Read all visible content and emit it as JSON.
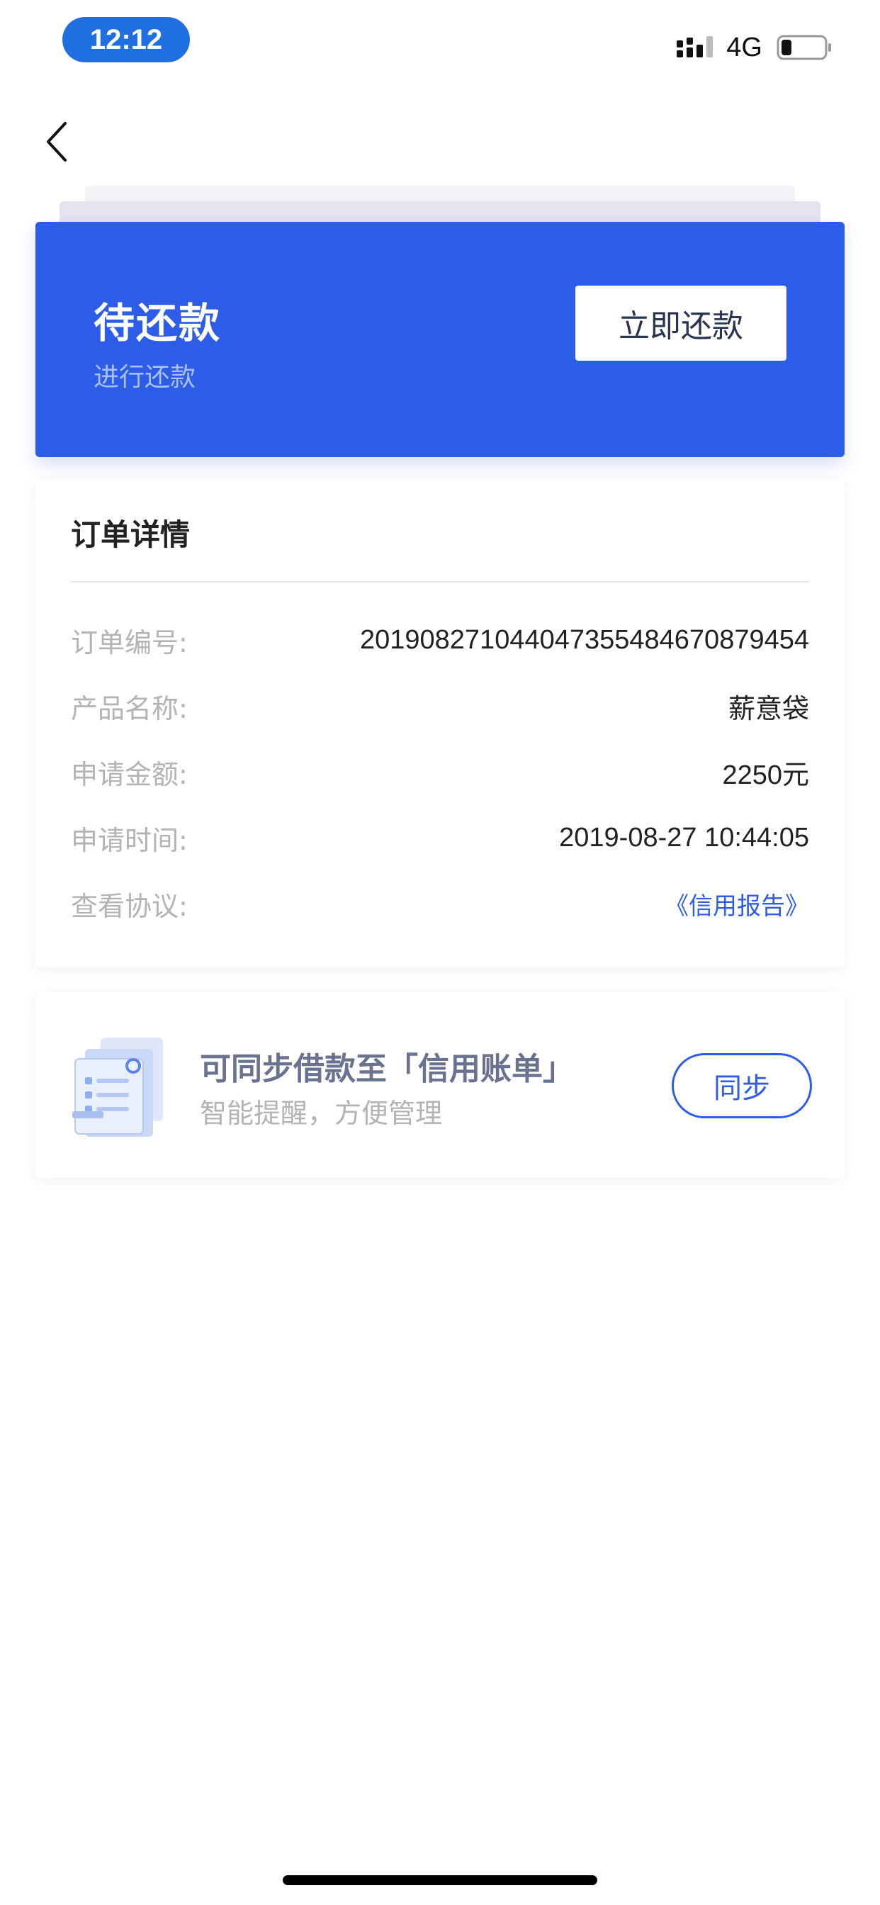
{
  "status_bar": {
    "time": "12:12",
    "network": "4G"
  },
  "header": {
    "back_icon": "chevron-left-icon"
  },
  "status_card": {
    "title": "待还款",
    "subtitle": "进行还款",
    "action_label": "立即还款",
    "background_color": "#2d5ce6"
  },
  "order_details": {
    "title": "订单详情",
    "rows": [
      {
        "label": "订单编号:",
        "value": "20190827104404735548467087945 4"
      },
      {
        "label": "产品名称:",
        "value": "薪意袋"
      },
      {
        "label": "申请金额:",
        "value": "2250元"
      },
      {
        "label": "申请时间:",
        "value": "2019-08-27 10:44:05"
      }
    ],
    "agreement": {
      "label": "查看协议:",
      "link_text": "《信用报告》"
    }
  },
  "sync_card": {
    "icon": "bill-document-icon",
    "title": "可同步借款至「信用账单」",
    "subtitle": "智能提醒，方便管理",
    "button_label": "同步"
  },
  "colors": {
    "accent": "#2d5ce6",
    "label_gray": "#b3b3b3",
    "text_dark": "#222222"
  }
}
